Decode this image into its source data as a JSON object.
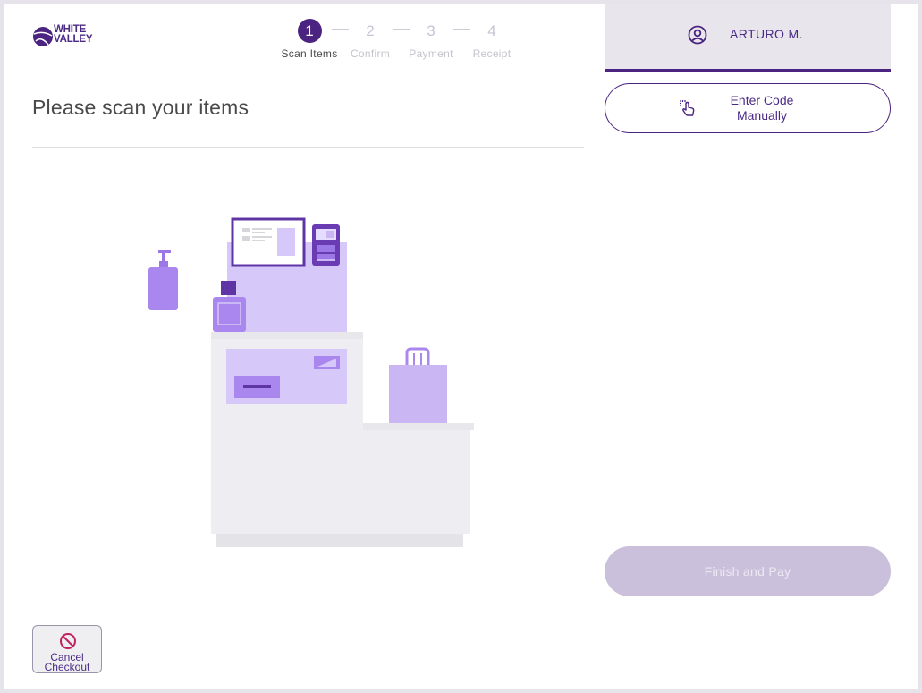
{
  "brand": {
    "line1": "WHITE",
    "line2": "VALLEY"
  },
  "stepper": {
    "steps": [
      {
        "num": "1",
        "label": "Scan Items"
      },
      {
        "num": "2",
        "label": "Confirm"
      },
      {
        "num": "3",
        "label": "Payment"
      },
      {
        "num": "4",
        "label": "Receipt"
      }
    ],
    "active_step": 1
  },
  "main": {
    "title": "Please scan your items"
  },
  "cancel": {
    "line1": "Cancel",
    "line2": "Checkout",
    "icon": "prohibited-icon"
  },
  "user": {
    "name": "ARTURO M.",
    "icon": "user-circle-icon"
  },
  "enter_code": {
    "line1": "Enter Code",
    "line2": "Manually",
    "icon": "tap-hand-icon"
  },
  "finish": {
    "label": "Finish and Pay"
  },
  "colors": {
    "accent": "#4b2380",
    "accent_light": "#cbc0db",
    "illustration": "#c9b6f2"
  }
}
